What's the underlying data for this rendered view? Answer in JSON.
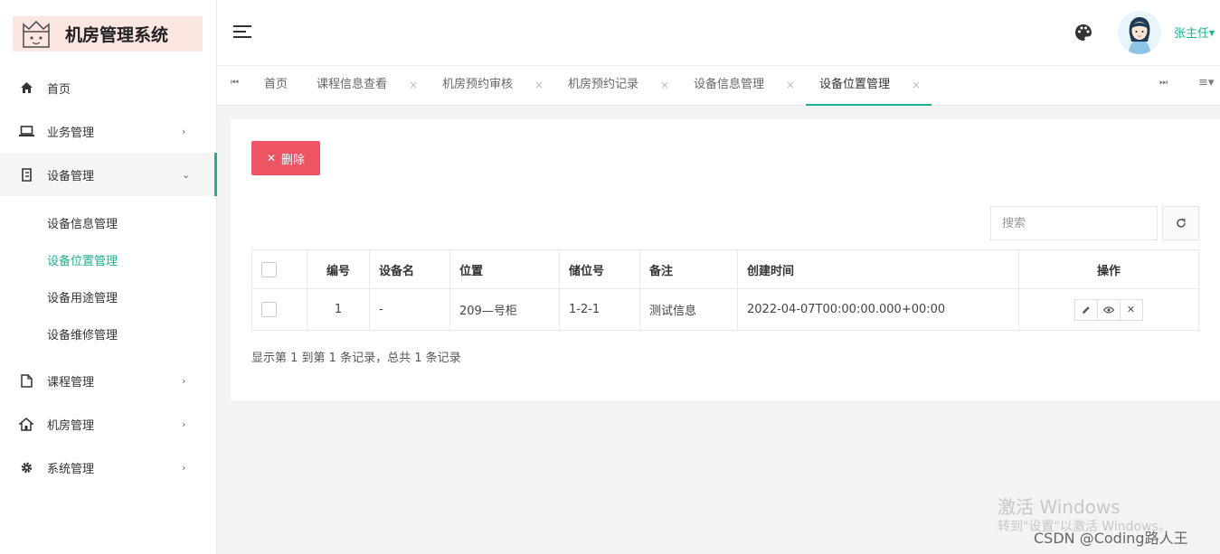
{
  "app": {
    "title": "机房管理系统"
  },
  "sidebar": {
    "items": [
      {
        "label": "首页",
        "icon": "home-icon"
      },
      {
        "label": "业务管理",
        "icon": "laptop-icon"
      },
      {
        "label": "设备管理",
        "icon": "device-icon"
      },
      {
        "label": "课程管理",
        "icon": "file-icon"
      },
      {
        "label": "机房管理",
        "icon": "building-icon"
      },
      {
        "label": "系统管理",
        "icon": "gear-icon"
      }
    ],
    "sub_items": [
      "设备信息管理",
      "设备位置管理",
      "设备用途管理",
      "设备维修管理"
    ],
    "active_sub": "设备位置管理"
  },
  "header": {
    "username": "张主任"
  },
  "tabs": [
    {
      "label": "首页"
    },
    {
      "label": "课程信息查看"
    },
    {
      "label": "机房预约审核"
    },
    {
      "label": "机房预约记录"
    },
    {
      "label": "设备信息管理"
    },
    {
      "label": "设备位置管理"
    }
  ],
  "toolbar": {
    "delete_label": "删除"
  },
  "search": {
    "placeholder": "搜索"
  },
  "table": {
    "headers": [
      "编号",
      "设备名",
      "位置",
      "储位号",
      "备注",
      "创建时间",
      "操作"
    ],
    "rows": [
      {
        "id": "1",
        "name": "-",
        "location": "209—号柜",
        "slot": "1-2-1",
        "remark": "测试信息",
        "created": "2022-04-07T00:00:00.000+00:00"
      }
    ]
  },
  "pagination": {
    "info": "显示第 1 到第 1 条记录，总共 1 条记录"
  },
  "watermark": {
    "line1": "激活 Windows",
    "line2": "转到\"设置\"以激活 Windows。",
    "credit": "CSDN @Coding路人王"
  },
  "colors": {
    "accent": "#1ab394",
    "danger": "#ed5565"
  }
}
